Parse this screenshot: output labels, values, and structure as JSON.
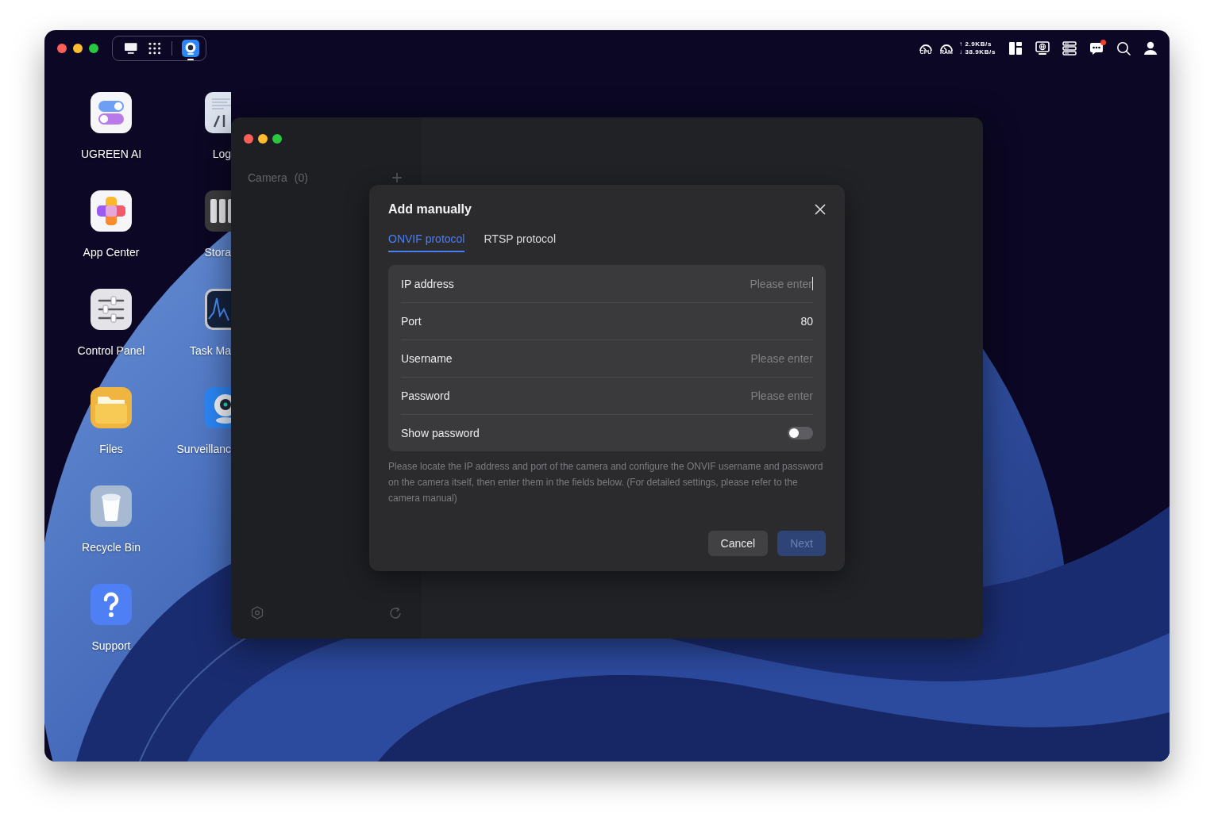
{
  "dock": {
    "app_running": true
  },
  "status_bar": {
    "cpu_label": "CPU",
    "ram_label": "RAM",
    "upload": "↑ 2.9KB/s",
    "download": "↓ 38.9KB/s",
    "messages_unread": true
  },
  "desktop_columns": [
    {
      "icons": [
        {
          "label": "UGREEN AI",
          "kind": "ai"
        },
        {
          "label": "App Center",
          "kind": "appcenter"
        },
        {
          "label": "Control Panel",
          "kind": "controlpanel"
        },
        {
          "label": "Files",
          "kind": "files"
        },
        {
          "label": "Recycle Bin",
          "kind": "recyclebin"
        },
        {
          "label": "Support",
          "kind": "support"
        }
      ]
    },
    {
      "icons": [
        {
          "label": "Log",
          "kind": "log"
        },
        {
          "label": "Stora",
          "kind": "storage"
        },
        {
          "label": "Task Ma",
          "kind": "taskmanager"
        },
        {
          "label": "Surveillanc",
          "kind": "surveillance"
        }
      ]
    }
  ],
  "window": {
    "sidebar": {
      "title": "Camera",
      "count": "(0)"
    },
    "dialog": {
      "title": "Add manually",
      "tabs": [
        {
          "label": "ONVIF protocol",
          "selected": true
        },
        {
          "label": "RTSP protocol",
          "selected": false
        }
      ],
      "fields": [
        {
          "label": "IP address",
          "kind": "input",
          "placeholder": "Please enter",
          "focused": true
        },
        {
          "label": "Port",
          "kind": "input",
          "value": "80",
          "focused": false
        },
        {
          "label": "Username",
          "kind": "input",
          "placeholder": "Please enter",
          "focused": false
        },
        {
          "label": "Password",
          "kind": "input",
          "placeholder": "Please enter",
          "focused": false
        },
        {
          "label": "Show password",
          "kind": "toggle",
          "on": false
        }
      ],
      "help": "Please locate the IP address and port of the camera and configure the ONVIF username and password on the camera itself, then enter them in the fields below. (For detailed settings, please refer to the camera manual)",
      "buttons": [
        {
          "label": "Cancel",
          "kind": "secondary",
          "disabled": false
        },
        {
          "label": "Next",
          "kind": "primary",
          "disabled": true
        }
      ]
    }
  }
}
